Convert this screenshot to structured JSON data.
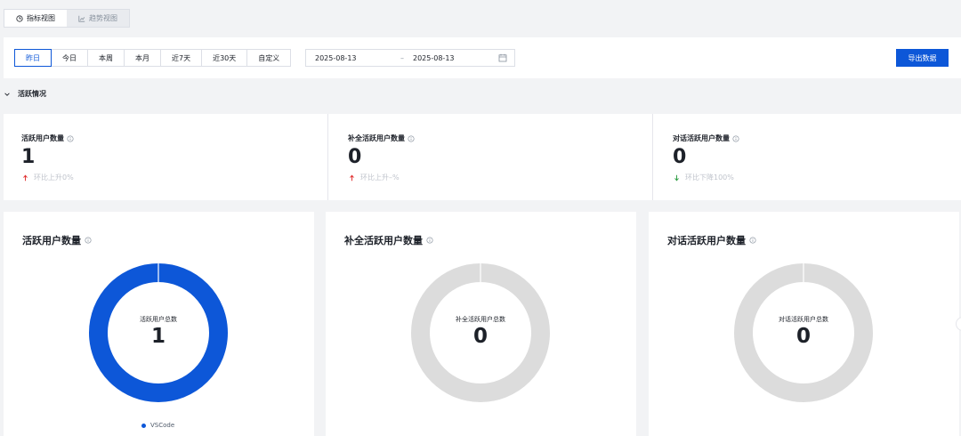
{
  "views": {
    "indicator": "指标视图",
    "trend": "趋势视图"
  },
  "toolbar": {
    "quick_ranges": [
      "昨日",
      "今日",
      "本周",
      "本月",
      "近7天",
      "近30天",
      "自定义"
    ],
    "active_index": 0,
    "date_start": "2025-08-13",
    "date_separator": "–",
    "date_end": "2025-08-13",
    "export_label": "导出数据"
  },
  "section": {
    "title": "活跃情况"
  },
  "stats": [
    {
      "title": "活跃用户数量",
      "value": "1",
      "trend": "环比上升0%",
      "direction": "up"
    },
    {
      "title": "补全活跃用户数量",
      "value": "0",
      "trend": "环比上升–%",
      "direction": "up"
    },
    {
      "title": "对话活跃用户数量",
      "value": "0",
      "trend": "环比下降100%",
      "direction": "down"
    }
  ],
  "charts": [
    {
      "title": "活跃用户数量",
      "center_label": "活跃用户总数",
      "total": "1",
      "legend": "VSCode"
    },
    {
      "title": "补全活跃用户数量",
      "center_label": "补全活跃用户总数",
      "total": "0",
      "legend": ""
    },
    {
      "title": "对话活跃用户数量",
      "center_label": "对话活跃用户总数",
      "total": "0",
      "legend": ""
    }
  ],
  "chart_data": [
    {
      "type": "pie",
      "categories": [
        "VSCode"
      ],
      "values": [
        1
      ],
      "title": "活跃用户数量"
    },
    {
      "type": "pie",
      "categories": [],
      "values": [],
      "title": "补全活跃用户数量"
    },
    {
      "type": "pie",
      "categories": [],
      "values": [],
      "title": "对话活跃用户数量"
    }
  ],
  "colors": {
    "primary": "#0d57d8",
    "empty_ring": "#dcdcdc",
    "trend_up": "#e03131",
    "trend_down": "#2f9e44"
  },
  "icons": {
    "indicator": "clock-pie-icon",
    "trend": "line-chart-icon",
    "calendar": "calendar-icon",
    "collapse": "chevron-down-icon",
    "info": "info-circle-icon"
  }
}
